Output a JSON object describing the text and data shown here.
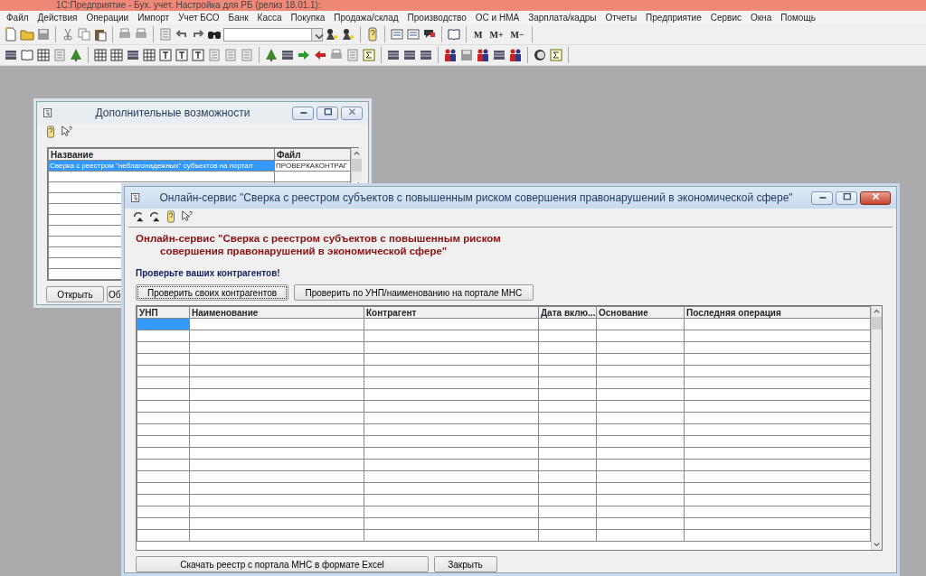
{
  "app": {
    "title": "1С:Предприятие - Бух. учет. Настройка для РБ (релиз 18.01.1):"
  },
  "menu": [
    "Файл",
    "Действия",
    "Операции",
    "Импорт",
    "Учет БСО",
    "Банк",
    "Касса",
    "Покупка",
    "Продажа/склад",
    "Производство",
    "ОС и НМА",
    "Зарплата/кадры",
    "Отчеты",
    "Предприятие",
    "Сервис",
    "Окна",
    "Помощь"
  ],
  "toolbar": {
    "memory_buttons": [
      "M",
      "M+",
      "M−"
    ]
  },
  "windows": [
    {
      "title": "Дополнительные возможности",
      "active": false,
      "table": {
        "columns": [
          "Название",
          "Файл"
        ],
        "rows": [
          {
            "cells": [
              "Сверка с реестром \"неблагонадежных\" субъектов на портал",
              "ПРОВЕРКАКОНТРАГ"
            ],
            "selected": true
          }
        ]
      },
      "buttons": [
        "Открыть",
        "Об"
      ]
    },
    {
      "title": "Онлайн-сервис \"Сверка с реестром субъектов с повышенным риском совершения правонарушений в экономической сфере\"",
      "active": true,
      "heading": [
        "Онлайн-сервис \"Сверка с реестром субъектов с повышенным риском",
        "совершения правонарушений в экономической сфере\""
      ],
      "prompt": "Проверьте ваших контрагентов!",
      "top_buttons": [
        {
          "label": "Проверить своих контрагентов",
          "focused": true
        },
        {
          "label": "Проверить по УНП/наименованию на портале МНС",
          "focused": false
        }
      ],
      "table": {
        "columns": [
          "УНП",
          "Наименование",
          "Контрагент",
          "Дата вклю...",
          "Основание",
          "Последняя операция"
        ],
        "rows": [
          {
            "selected": true
          },
          {
            "selected": false
          },
          {
            "selected": false
          },
          {
            "selected": false
          },
          {
            "selected": false
          },
          {
            "selected": false
          },
          {
            "selected": false
          },
          {
            "selected": false
          },
          {
            "selected": false
          },
          {
            "selected": false
          },
          {
            "selected": false
          },
          {
            "selected": false
          },
          {
            "selected": false
          },
          {
            "selected": false
          },
          {
            "selected": false
          },
          {
            "selected": false
          },
          {
            "selected": false
          },
          {
            "selected": false
          },
          {
            "selected": false
          }
        ]
      },
      "buttons": [
        "Скачать реестр с портала МНС в формате Excel",
        "Закрыть"
      ]
    }
  ]
}
